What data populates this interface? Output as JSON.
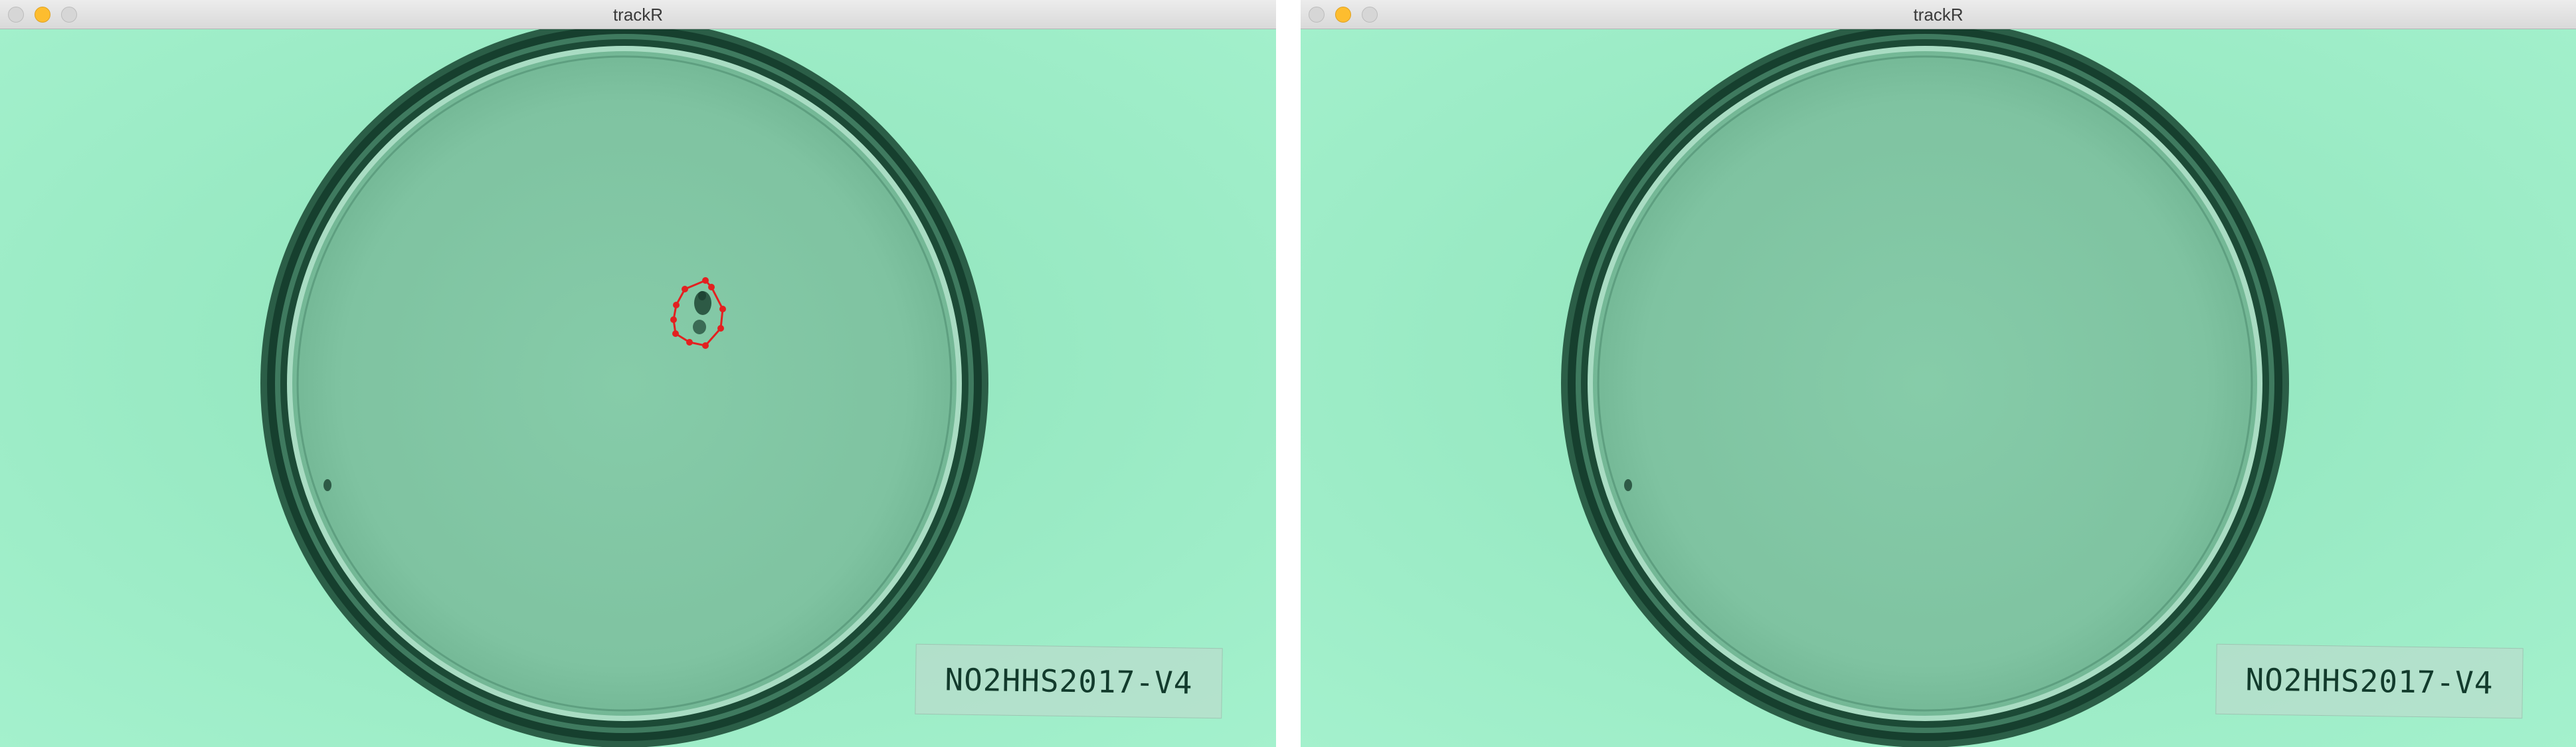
{
  "colors": {
    "background": "#96ebc2",
    "dish_fill": "#82c8a6",
    "dish_rim": "#0f3a29",
    "traffic_close": "#d6d6d6",
    "traffic_minimize": "#fdbd2f",
    "traffic_zoom": "#d6d6d6",
    "track_outline": "#e32020"
  },
  "windows": [
    {
      "title": "trackR",
      "dish_label": "NO2HHS2017-V4",
      "tracking_overlay": true,
      "traffic_lights": {
        "close": "close-icon",
        "minimize": "minimize-icon",
        "zoom": "zoom-icon"
      }
    },
    {
      "title": "trackR",
      "dish_label": "NO2HHS2017-V4",
      "tracking_overlay": false,
      "traffic_lights": {
        "close": "close-icon",
        "minimize": "minimize-icon",
        "zoom": "zoom-icon"
      }
    }
  ]
}
